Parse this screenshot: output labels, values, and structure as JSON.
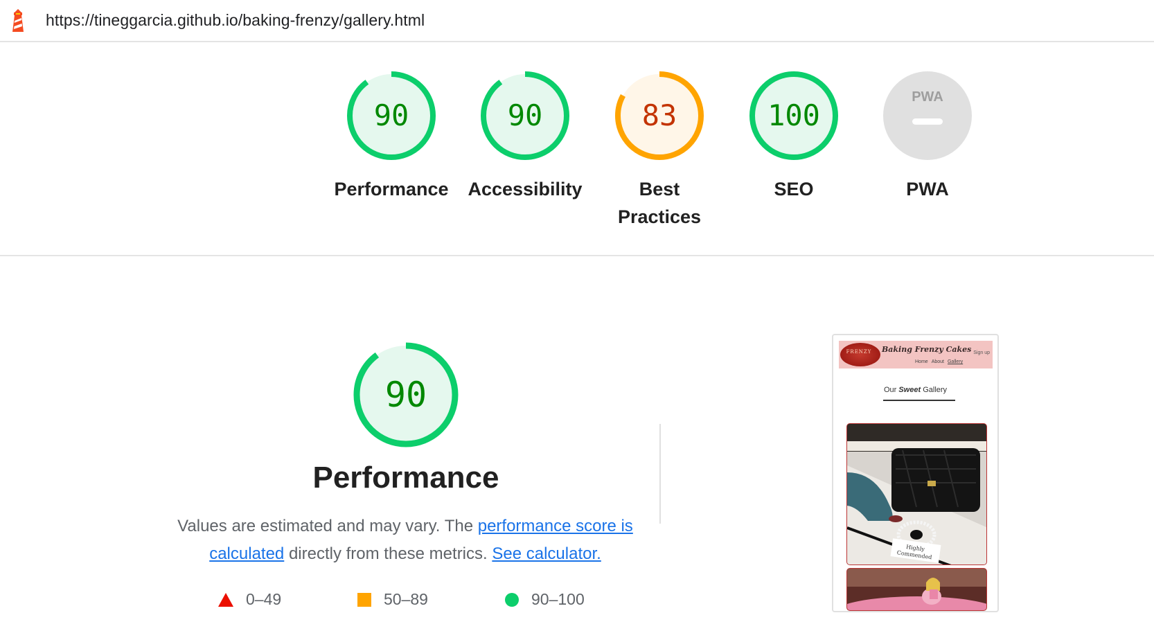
{
  "browser": {
    "url": "https://tineggarcia.github.io/baking-frenzy/gallery.html"
  },
  "colors": {
    "pass": "#0cce6b",
    "pass_text": "#008800",
    "average": "#ffa400",
    "average_text": "#c33300",
    "fail": "#eb0f00",
    "pwa_gray": "#e0e0e0",
    "link": "#1a73e8"
  },
  "categories": [
    {
      "id": "performance",
      "label": "Performance",
      "score": "90",
      "score_fraction": 0.9,
      "rating": "pass"
    },
    {
      "id": "accessibility",
      "label": "Accessibility",
      "score": "90",
      "score_fraction": 0.9,
      "rating": "pass"
    },
    {
      "id": "best-practices",
      "label_line1": "Best",
      "label_line2": "Practices",
      "score": "83",
      "score_fraction": 0.83,
      "rating": "average"
    },
    {
      "id": "seo",
      "label": "SEO",
      "score": "100",
      "score_fraction": 1.0,
      "rating": "pass"
    },
    {
      "id": "pwa",
      "label": "PWA",
      "badge_text": "PWA",
      "rating": "na"
    }
  ],
  "performance_section": {
    "score": "90",
    "score_fraction": 0.9,
    "title": "Performance",
    "description_prefix": "Values are estimated and may vary. The ",
    "link_score": "performance score is calculated",
    "description_middle": " directly from these metrics. ",
    "link_calculator": "See calculator."
  },
  "legend": [
    {
      "icon": "triangle-icon",
      "range": "0–49"
    },
    {
      "icon": "square-icon",
      "range": "50–89"
    },
    {
      "icon": "circle-icon",
      "range": "90–100"
    }
  ],
  "screenshot": {
    "logo_text": "FRENZY",
    "brand": "Baking Frenzy Cakes",
    "signup": "Sign up",
    "nav": [
      "Home",
      "About",
      "Gallery"
    ],
    "gallery_title_pre": "Our ",
    "gallery_title_em": "Sweet",
    "gallery_title_post": " Gallery",
    "caption": "Highly Commended"
  }
}
